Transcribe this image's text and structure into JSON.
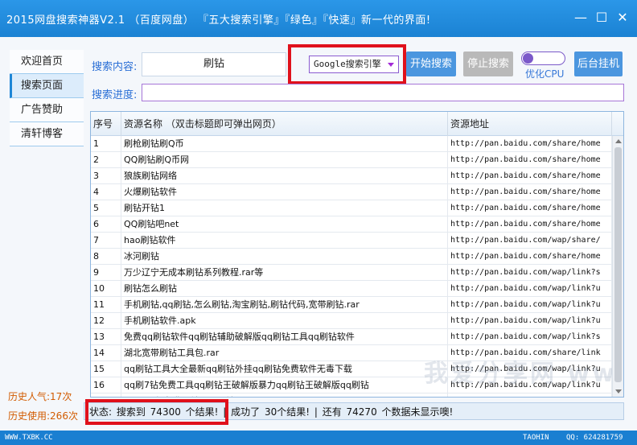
{
  "app": {
    "title": "2015网盘搜索神器V2.1   （百度网盘）  『五大搜索引擎』『绿色』『快速』新一代的界面!"
  },
  "window_controls": {
    "minimize": "—",
    "maximize": "☐",
    "close": "✕"
  },
  "sidebar": {
    "items": [
      {
        "label": "欢迎首页",
        "active": false
      },
      {
        "label": "搜索页面",
        "active": true
      },
      {
        "label": "广告赞助",
        "active": false
      },
      {
        "label": "清轩博客",
        "active": false
      }
    ],
    "history_popularity": "历史人气:17次",
    "history_usage": "历史使用:266次"
  },
  "search": {
    "content_label": "搜索内容:",
    "query": "刷钻",
    "engine_selected": "Google搜索引擎",
    "start_button": "开始搜索",
    "stop_button": "停止搜索",
    "cpu_toggle_label": "优化CPU",
    "background_button": "后台挂机",
    "progress_label": "搜索进度:"
  },
  "table": {
    "columns": [
      "序号",
      "资源名称 （双击标题即可弹出网页）",
      "资源地址"
    ],
    "rows": [
      [
        "1",
        "刷枪刷钻刷Q币",
        "http://pan.baidu.com/share/home"
      ],
      [
        "2",
        "QQ刷钻刷Q币网",
        "http://pan.baidu.com/share/home"
      ],
      [
        "3",
        "狼族刷钻网络",
        "http://pan.baidu.com/share/home"
      ],
      [
        "4",
        "火爆刷钻软件",
        "http://pan.baidu.com/share/home"
      ],
      [
        "5",
        "刷钻开钻1",
        "http://pan.baidu.com/share/home"
      ],
      [
        "6",
        "QQ刷钻吧net",
        "http://pan.baidu.com/share/home"
      ],
      [
        "7",
        "hao刷钻软件",
        "http://pan.baidu.com/wap/share/"
      ],
      [
        "8",
        "冰河刷钻",
        "http://pan.baidu.com/share/home"
      ],
      [
        "9",
        "万少辽宁无成本刷钻系列教程.rar等",
        "http://pan.baidu.com/wap/link?s"
      ],
      [
        "10",
        "刷钻怎么刷钻",
        "http://pan.baidu.com/wap/link?u"
      ],
      [
        "11",
        "手机刷钻,qq刷钻,怎么刷钻,淘宝刷钻,刷钻代码,宽带刷钻.rar",
        "http://pan.baidu.com/wap/link?u"
      ],
      [
        "12",
        "手机刷钻软件.apk",
        "http://pan.baidu.com/wap/link?u"
      ],
      [
        "13",
        "免费qq刷钻软件qq刷钻辅助破解版qq刷钻工具qq刷钻软件",
        "http://pan.baidu.com/wap/link?s"
      ],
      [
        "14",
        "湖北宽带刷钻工具包.rar",
        "http://pan.baidu.com/share/link"
      ],
      [
        "15",
        "qq刷钻工具大全最新qq刷钻外挂qq刷钻免费软件无毒下载",
        "http://pan.baidu.com/wap/link?u"
      ],
      [
        "16",
        "qq刷7钻免费工具qq刷钻王破解版暴力qq刷钻王破解版qq刷钻",
        "http://pan.baidu.com/wap/link?u"
      ],
      [
        "17",
        "1010最新免费刷钻工具刷钻",
        "http://pan.baidu.com/wap/link?u"
      ]
    ]
  },
  "status": {
    "text": "状态: 搜索到  74300  个结果!   | 成功了  30个结果!   | 还有  74270 个数据未显示噢!"
  },
  "watermark": "我爱分享网 www.52fzba.com",
  "footer": {
    "left": "WWW.TXBK.CC",
    "author": "TAOHIN",
    "contact": "QQ: 624281759"
  },
  "colors": {
    "window_blue": "#1e86d6",
    "highlight_red": "#e0111b",
    "history_orange": "#d25b00",
    "label_blue": "#2a6fd6",
    "button_blue": "#4b96df",
    "button_gray": "#b9b9b9"
  }
}
